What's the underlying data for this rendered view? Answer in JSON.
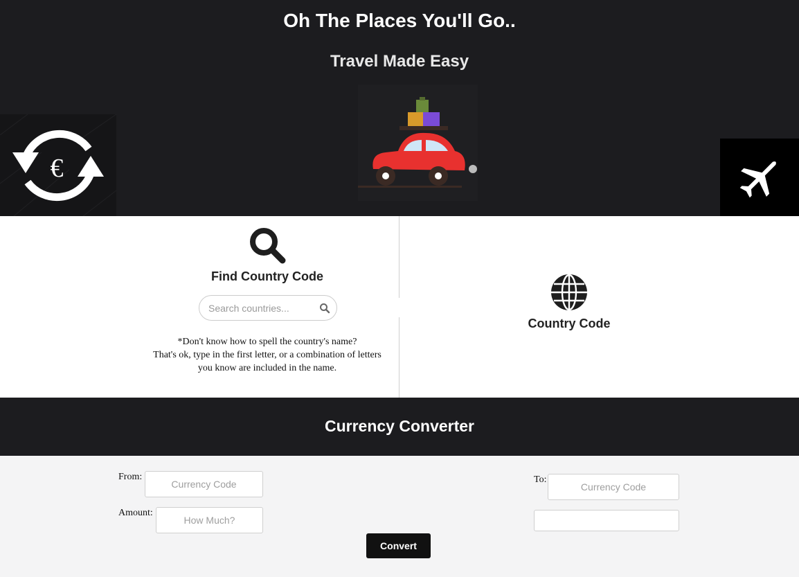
{
  "header": {
    "title": "Oh The Places You'll Go..",
    "subtitle": "Travel Made Easy"
  },
  "images": {
    "left": "currency-exchange-euro-icon",
    "center": "car-with-luggage-illustration",
    "right": "airplane-icon"
  },
  "find_country": {
    "icon": "search-icon",
    "title": "Find Country Code",
    "search_placeholder": "Search countries...",
    "search_value": "",
    "hint_lines": [
      "*Don't know how to spell the country's name?",
      "That's ok, type in the first letter, or a combination of letters",
      "you know are included in the name."
    ]
  },
  "country_code": {
    "icon": "globe-icon",
    "title": "Country Code"
  },
  "converter": {
    "title": "Currency Converter",
    "from_label": "From:",
    "from_placeholder": "Currency Code",
    "amount_label": "Amount:",
    "amount_placeholder": "How Much?",
    "to_label": "To:",
    "to_placeholder": "Currency Code",
    "result_value": "",
    "convert_label": "Convert"
  }
}
